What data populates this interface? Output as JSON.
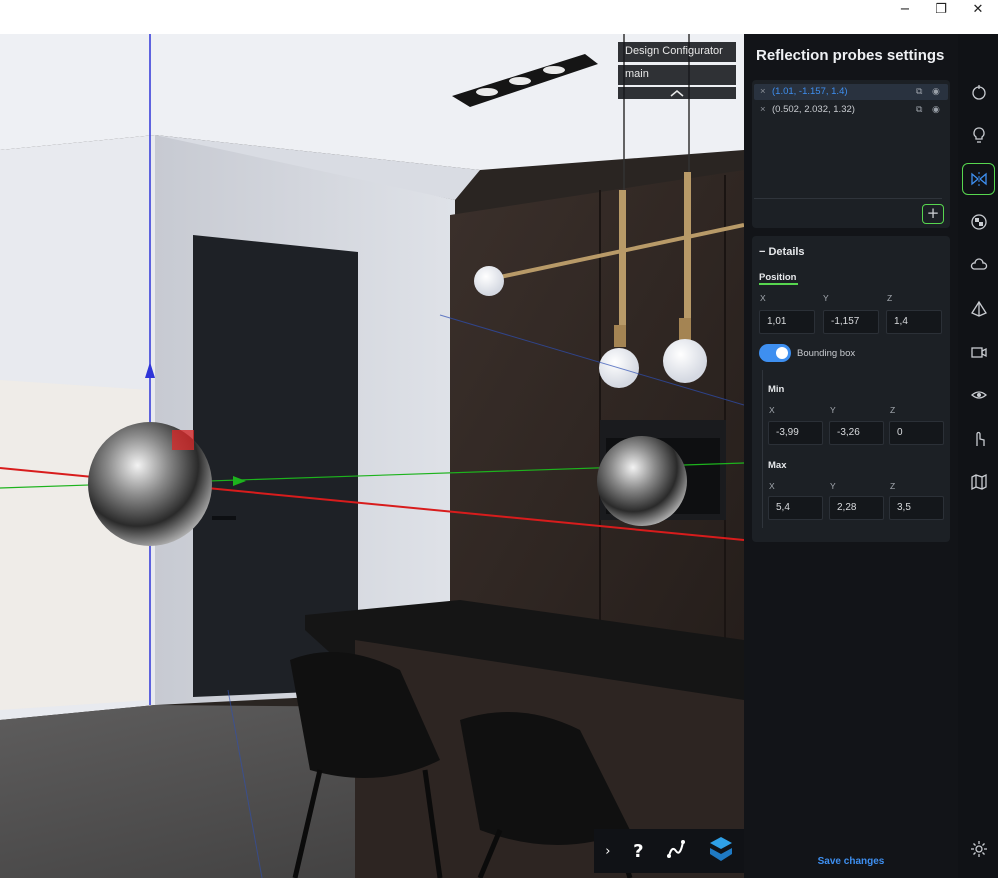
{
  "window": {
    "minimize_icon": "minimize-icon",
    "maximize_icon": "restore-icon",
    "close_icon": "close-icon",
    "minimize_glyph": "−",
    "maximize_glyph": "❐",
    "close_glyph": "✕"
  },
  "viewport": {
    "configurator_name": "Design Configurator",
    "branch": "main",
    "collapse_icon": "chevron-up-icon"
  },
  "toolbar": {
    "expand_glyph": "›",
    "help_glyph": "?",
    "expand_icon": "chevron-right-icon",
    "help_icon": "help-icon",
    "path_icon": "curve-path-icon",
    "logo_icon": "app-logo-icon"
  },
  "panel": {
    "title": "Reflection probes settings",
    "probes": [
      {
        "label": "(1.01, -1.157, 1.4)",
        "selected": true
      },
      {
        "label": "(0.502, 2.032, 1.32)",
        "selected": false
      }
    ],
    "remove_glyph": "×",
    "add_glyph": "+",
    "details": {
      "title": "− Details",
      "position_label": "Position",
      "position": {
        "x_label": "X",
        "y_label": "Y",
        "z_label": "Z",
        "x": "1,01",
        "y": "-1,157",
        "z": "1,4"
      },
      "bounding_box_label": "Bounding box",
      "bounding_box_enabled": true,
      "min_label": "Min",
      "min": {
        "x_label": "X",
        "y_label": "Y",
        "z_label": "Z",
        "x": "-3,99",
        "y": "-3,26",
        "z": "0"
      },
      "max_label": "Max",
      "max": {
        "x_label": "X",
        "y_label": "Y",
        "z_label": "Z",
        "x": "5,4",
        "y": "2,28",
        "z": "3,5"
      }
    },
    "save_label": "Save changes"
  },
  "sidebar_icons": [
    "timer-icon",
    "lightbulb-icon",
    "reflection-probe-icon",
    "material-ball-icon",
    "cloud-icon",
    "pyramid-icon",
    "camera-icon",
    "eye-icon",
    "hand-pointer-icon",
    "map-icon",
    "settings-icon"
  ],
  "colors": {
    "accent_green": "#57d64f",
    "accent_blue": "#3e8ff0",
    "panel_bg": "#121418",
    "card_bg": "#1c2025"
  }
}
